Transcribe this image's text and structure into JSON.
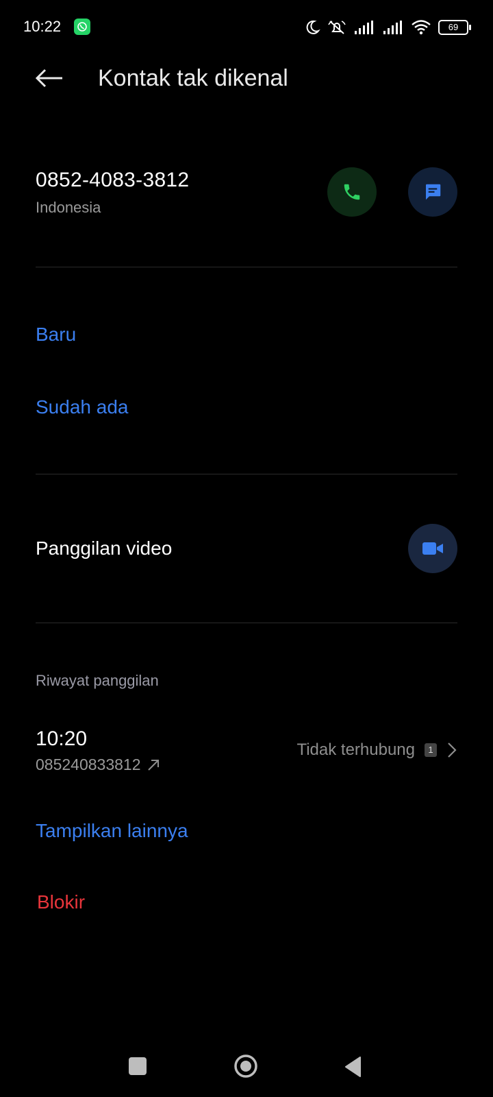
{
  "status_bar": {
    "time": "10:22",
    "battery": "69",
    "icons": [
      "whatsapp-icon",
      "moon-icon",
      "silent-icon",
      "signal-icon",
      "signal-icon",
      "wifi-icon",
      "battery-icon"
    ]
  },
  "header": {
    "back_icon": "arrow-left-icon",
    "title": "Kontak tak dikenal"
  },
  "contact": {
    "number": "0852-4083-3812",
    "country": "Indonesia",
    "call_icon": "phone-icon",
    "message_icon": "message-icon"
  },
  "add_options": {
    "new": "Baru",
    "existing": "Sudah ada"
  },
  "video_call": {
    "label": "Panggilan video",
    "icon": "video-camera-icon"
  },
  "call_history": {
    "heading": "Riwayat panggilan",
    "entries": [
      {
        "time": "10:20",
        "number": "085240833812",
        "direction_icon": "outgoing-arrow-icon",
        "status": "Tidak terhubung",
        "count": "1"
      }
    ],
    "show_more": "Tampilkan lainnya"
  },
  "block": {
    "label": "Blokir"
  },
  "colors": {
    "background": "#000000",
    "accent_blue": "#3b7ff0",
    "danger_red": "#e8353b",
    "call_green": "#2fd062"
  }
}
